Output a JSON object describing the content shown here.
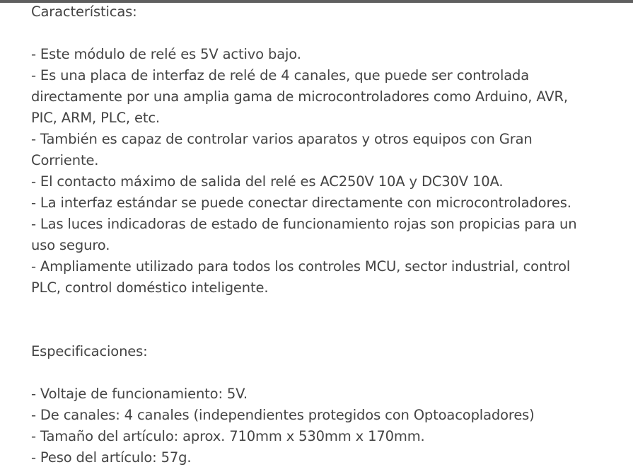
{
  "characteristics": {
    "heading": "Características:",
    "lines": [
      "- Este módulo de relé es 5V activo bajo.",
      "- Es una placa de interfaz de relé de 4 canales, que puede ser controlada",
      "directamente por una amplia gama de microcontroladores como Arduino, AVR,",
      "PIC, ARM, PLC, etc.",
      "- También es capaz de controlar varios aparatos y otros equipos con Gran",
      "Corriente.",
      "- El contacto máximo de salida del relé es AC250V 10A y DC30V 10A.",
      "- La interfaz estándar se puede conectar directamente con microcontroladores.",
      "- Las luces indicadoras de estado de funcionamiento rojas son propicias para un",
      "uso seguro.",
      "- Ampliamente utilizado para todos los controles MCU, sector industrial, control",
      "PLC, control doméstico inteligente."
    ]
  },
  "specifications": {
    "heading": "Especificaciones:",
    "lines": [
      "- Voltaje de funcionamiento: 5V.",
      "- De canales: 4 canales (independientes protegidos con Optoacopladores)",
      "- Tamaño del artículo: aprox. 710mm x 530mm x 170mm.",
      "- Peso del artículo: 57g."
    ]
  }
}
